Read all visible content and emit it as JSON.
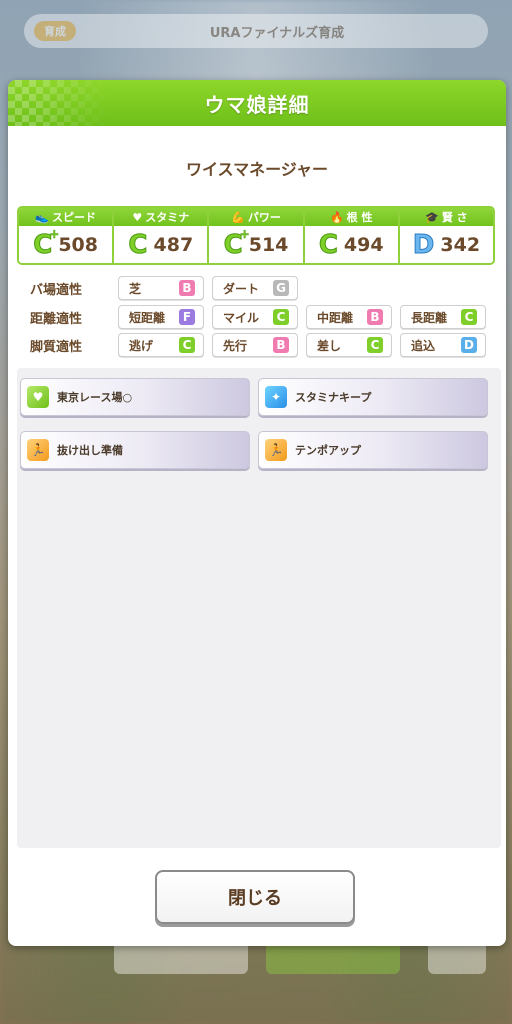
{
  "background": {
    "top_pill": "育成",
    "top_title": "URAファイナルズ育成"
  },
  "dialog": {
    "title": "ウマ娘詳細",
    "character_name": "ワイスマネージャー",
    "stats": [
      {
        "label": "スピード",
        "icon": "shoe-icon",
        "grade": "C",
        "plus": true,
        "value": "508"
      },
      {
        "label": "スタミナ",
        "icon": "heart-icon",
        "grade": "C",
        "plus": false,
        "value": "487"
      },
      {
        "label": "パワー",
        "icon": "arm-icon",
        "grade": "C",
        "plus": true,
        "value": "514"
      },
      {
        "label": "根 性",
        "icon": "flame-icon",
        "grade": "C",
        "plus": false,
        "value": "494"
      },
      {
        "label": "賢 さ",
        "icon": "graduation-cap-icon",
        "grade": "D",
        "plus": false,
        "value": "342"
      }
    ],
    "aptitude": {
      "track": {
        "label": "バ場適性",
        "items": [
          {
            "name": "芝",
            "grade": "B"
          },
          {
            "name": "ダート",
            "grade": "G"
          }
        ]
      },
      "distance": {
        "label": "距離適性",
        "items": [
          {
            "name": "短距離",
            "grade": "F"
          },
          {
            "name": "マイル",
            "grade": "C"
          },
          {
            "name": "中距離",
            "grade": "B"
          },
          {
            "name": "長距離",
            "grade": "C"
          }
        ]
      },
      "style": {
        "label": "脚質適性",
        "items": [
          {
            "name": "逃げ",
            "grade": "C"
          },
          {
            "name": "先行",
            "grade": "B"
          },
          {
            "name": "差し",
            "grade": "C"
          },
          {
            "name": "追込",
            "grade": "D"
          }
        ]
      }
    },
    "skills": [
      {
        "name": "東京レース場○",
        "icon": "heart-skill-icon"
      },
      {
        "name": "スタミナキープ",
        "icon": "sparkle-skill-icon"
      },
      {
        "name": "抜け出し準備",
        "icon": "runner-skill-icon"
      },
      {
        "name": "テンポアップ",
        "icon": "runner-skill-icon"
      }
    ],
    "close_label": "閉じる"
  },
  "colors": {
    "header_green": "#7ecb22",
    "text_brown": "#6b4a2b",
    "grade_B": "#f07bb0",
    "grade_C": "#7ecf2a",
    "grade_D": "#5aaeea",
    "grade_F": "#9c7be0",
    "grade_G": "#b8b8b8"
  }
}
